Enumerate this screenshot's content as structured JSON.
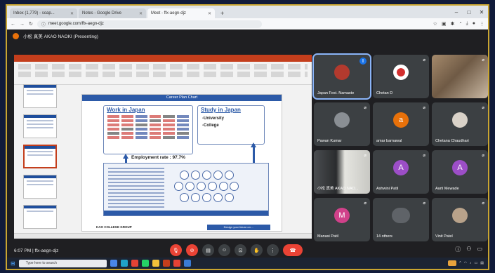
{
  "browser": {
    "tabs": [
      {
        "label": "Inbox (1,779) - soap..."
      },
      {
        "label": "Notes - Google Drive"
      },
      {
        "label": "Meet - ffx-aegn-djz"
      }
    ],
    "url": "meet.google.com/ffx-aegn-djz"
  },
  "meet": {
    "presenter_banner": "小松 真美 AKAO NAOKI (Presenting)",
    "participants": [
      {
        "name": "Japan Fest. Namaste",
        "kind": "photo",
        "color": "#b33a2e"
      },
      {
        "name": "Chetan D",
        "kind": "photo",
        "color": "#d32f2f"
      },
      {
        "name": "",
        "kind": "video",
        "color": "#8a6f55"
      },
      {
        "name": "Pawan Kumar",
        "kind": "photo",
        "color": "#8a8f94"
      },
      {
        "name": "amar barnawal",
        "kind": "initial",
        "initial": "a",
        "color": "#e8710a"
      },
      {
        "name": "Chetana Chaudhari",
        "kind": "photo",
        "color": "#d9d2c8"
      },
      {
        "name": "小松 真美 AKAO NAO...",
        "kind": "video",
        "color": "#dcdcd8"
      },
      {
        "name": "Ashwini Patil",
        "kind": "initial",
        "initial": "A",
        "color": "#9c4ec7"
      },
      {
        "name": "Aarti Mewade",
        "kind": "initial",
        "initial": "A",
        "color": "#9c4ec7"
      },
      {
        "name": "Manasi Patil",
        "kind": "initial",
        "initial": "M",
        "color": "#d0418a"
      },
      {
        "name": "14 others",
        "kind": "group",
        "color": "#5f6368"
      },
      {
        "name": "Vinit Patel",
        "kind": "photo",
        "color": "#b8a28a"
      }
    ],
    "footer": {
      "time": "6:07 PM",
      "separator": "|",
      "meeting_code": "ffx-aegn-djz"
    }
  },
  "slide": {
    "title": "Career Plan Chart",
    "work_title": "Work in Japan",
    "study_title": "Study in Japan",
    "study_items": [
      "-University",
      "-College"
    ],
    "employment_rate": "Employment rate : 97.7%",
    "group_logo": "KAO COLLEGE GROUP",
    "footer_band": "Design your future on ..."
  },
  "taskbar": {
    "search_placeholder": "Type here to search"
  }
}
